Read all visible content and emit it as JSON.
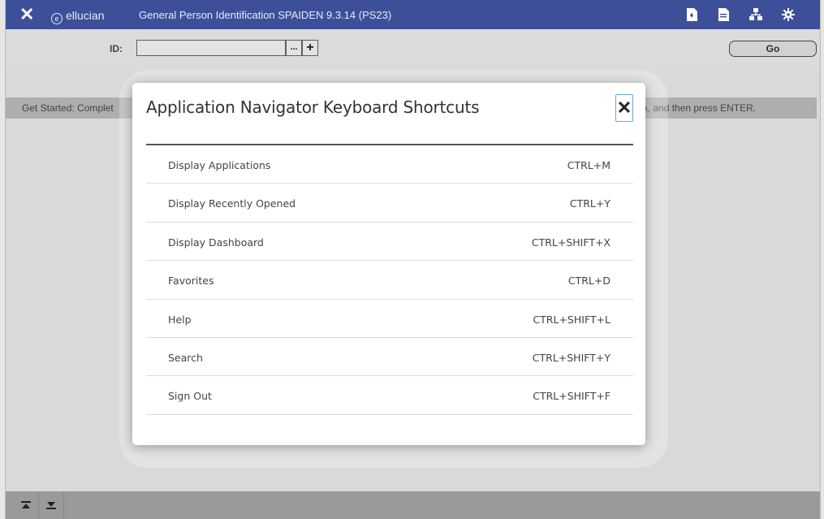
{
  "header": {
    "close_glyph": "✕",
    "brand": "ellucian",
    "title": "General Person Identification SPAIDEN 9.3.14 (PS23)",
    "icons": [
      "add-page-icon",
      "retrieve-icon",
      "related-icon",
      "tools-gear-icon"
    ]
  },
  "key_block": {
    "id_label": "ID:",
    "id_value": "",
    "lookup_label": "...",
    "add_label": "+",
    "go_label": "Go"
  },
  "get_started": {
    "left_text": "Get Started: Complet",
    "right_text": "a, and then press ENTER."
  },
  "modal": {
    "title": "Application Navigator Keyboard Shortcuts",
    "close_label": "✕",
    "shortcuts": [
      {
        "label": "Display Applications",
        "keys": "CTRL+M"
      },
      {
        "label": "Display Recently Opened",
        "keys": "CTRL+Y"
      },
      {
        "label": "Display Dashboard",
        "keys": "CTRL+SHIFT+X"
      },
      {
        "label": "Favorites",
        "keys": "CTRL+D"
      },
      {
        "label": "Help",
        "keys": "CTRL+SHIFT+L"
      },
      {
        "label": "Search",
        "keys": "CTRL+SHIFT+Y"
      },
      {
        "label": "Sign Out",
        "keys": "CTRL+SHIFT+F"
      }
    ]
  },
  "footer": {
    "icons": [
      "collapse-up-icon",
      "expand-down-icon"
    ]
  },
  "colors": {
    "header_bg": "#3e4f9a",
    "focus_outline": "#6aa3e8"
  }
}
